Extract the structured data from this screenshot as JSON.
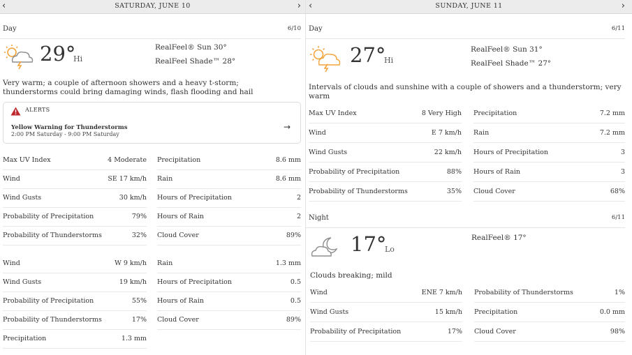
{
  "left": {
    "date": "SATURDAY, JUNE 10",
    "nav_prev": "‹",
    "nav_next": "›",
    "day": {
      "label": "Day",
      "date_short": "6/10",
      "icon": "thunderstorm-sun-icon",
      "temp": "29°",
      "hilo": "Hi",
      "realfeel_sun": "RealFeel® Sun 30°",
      "realfeel_shade": "RealFeel Shade™ 28°",
      "description": "Very warm; a couple of afternoon showers and a heavy t-storm; thunderstorms could bring damaging winds, flash flooding and hail",
      "alerts_label": "ALERTS",
      "alert_title": "Yellow Warning for Thunderstorms",
      "alert_time": "2:00 PM Saturday - 9:00 PM Saturday",
      "alert_arrow": "→",
      "details_left": [
        {
          "label": "Max UV Index",
          "value": "4 Moderate"
        },
        {
          "label": "Wind",
          "value": "SE 17 km/h"
        },
        {
          "label": "Wind Gusts",
          "value": "30 km/h"
        },
        {
          "label": "Probability of Precipitation",
          "value": "79%"
        },
        {
          "label": "Probability of Thunderstorms",
          "value": "32%"
        }
      ],
      "details_right": [
        {
          "label": "Precipitation",
          "value": "8.6 mm"
        },
        {
          "label": "Rain",
          "value": "8.6 mm"
        },
        {
          "label": "Hours of Precipitation",
          "value": "2"
        },
        {
          "label": "Hours of Rain",
          "value": "2"
        },
        {
          "label": "Cloud Cover",
          "value": "89%"
        }
      ]
    },
    "night": {
      "details_left": [
        {
          "label": "Wind",
          "value": "W 9 km/h"
        },
        {
          "label": "Wind Gusts",
          "value": "19 km/h"
        },
        {
          "label": "Probability of Precipitation",
          "value": "55%"
        },
        {
          "label": "Probability of Thunderstorms",
          "value": "17%"
        },
        {
          "label": "Precipitation",
          "value": "1.3 mm"
        }
      ],
      "details_right": [
        {
          "label": "Rain",
          "value": "1.3 mm"
        },
        {
          "label": "Hours of Precipitation",
          "value": "0.5"
        },
        {
          "label": "Hours of Rain",
          "value": "0.5"
        },
        {
          "label": "Cloud Cover",
          "value": "89%"
        }
      ]
    }
  },
  "right": {
    "date": "SUNDAY, JUNE 11",
    "nav_prev": "‹",
    "nav_next": "›",
    "day": {
      "label": "Day",
      "date_short": "6/11",
      "icon": "thunderstorm-sun-icon",
      "temp": "27°",
      "hilo": "Hi",
      "realfeel_sun": "RealFeel® Sun 31°",
      "realfeel_shade": "RealFeel Shade™ 27°",
      "description": "Intervals of clouds and sunshine with a couple of showers and a thunderstorm; very warm",
      "details_left": [
        {
          "label": "Max UV Index",
          "value": "8 Very High"
        },
        {
          "label": "Wind",
          "value": "E 7 km/h"
        },
        {
          "label": "Wind Gusts",
          "value": "22 km/h"
        },
        {
          "label": "Probability of Precipitation",
          "value": "88%"
        },
        {
          "label": "Probability of Thunderstorms",
          "value": "35%"
        }
      ],
      "details_right": [
        {
          "label": "Precipitation",
          "value": "7.2 mm"
        },
        {
          "label": "Rain",
          "value": "7.2 mm"
        },
        {
          "label": "Hours of Precipitation",
          "value": "3"
        },
        {
          "label": "Hours of Rain",
          "value": "3"
        },
        {
          "label": "Cloud Cover",
          "value": "68%"
        }
      ]
    },
    "night": {
      "label": "Night",
      "date_short": "6/11",
      "icon": "cloudy-moon-icon",
      "temp": "17°",
      "hilo": "Lo",
      "realfeel": "RealFeel® 17°",
      "description": "Clouds breaking; mild",
      "details_left": [
        {
          "label": "Wind",
          "value": "ENE 7 km/h"
        },
        {
          "label": "Wind Gusts",
          "value": "15 km/h"
        },
        {
          "label": "Probability of Precipitation",
          "value": "17%"
        }
      ],
      "details_right": [
        {
          "label": "Probability of Thunderstorms",
          "value": "1%"
        },
        {
          "label": "Precipitation",
          "value": "0.0 mm"
        },
        {
          "label": "Cloud Cover",
          "value": "98%"
        }
      ]
    }
  },
  "colors": {
    "alert_red": "#c0272d",
    "sun_orange": "#f2a33a",
    "cloud_gray": "#9a9a9a"
  }
}
